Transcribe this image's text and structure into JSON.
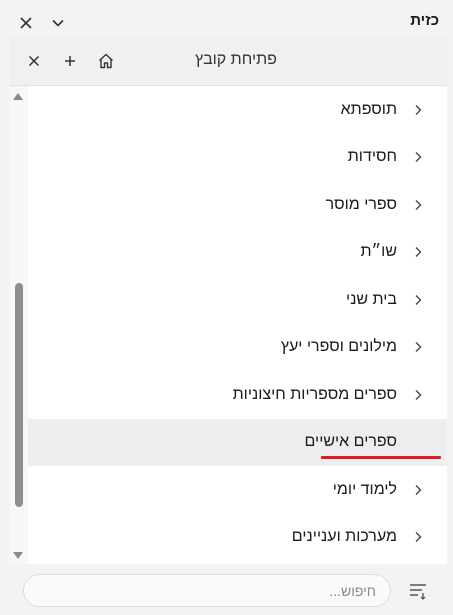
{
  "window": {
    "title": "כזית"
  },
  "tab": {
    "title": "פתיחת קובץ"
  },
  "tree": {
    "items": [
      {
        "label": "תוספתא"
      },
      {
        "label": "חסידות"
      },
      {
        "label": "ספרי מוסר"
      },
      {
        "label": "שו״ת"
      },
      {
        "label": "בית שני"
      },
      {
        "label": "מילונים וספרי יעץ"
      },
      {
        "label": "ספרים מספריות חיצוניות"
      },
      {
        "label": "ספרים אישיים"
      },
      {
        "label": "לימוד יומי"
      },
      {
        "label": "מערכות ועניינים"
      }
    ]
  },
  "search": {
    "placeholder": "חיפוש..."
  },
  "colors": {
    "accent_underline": "#e01b22",
    "selected_row": "#eeeeee"
  }
}
